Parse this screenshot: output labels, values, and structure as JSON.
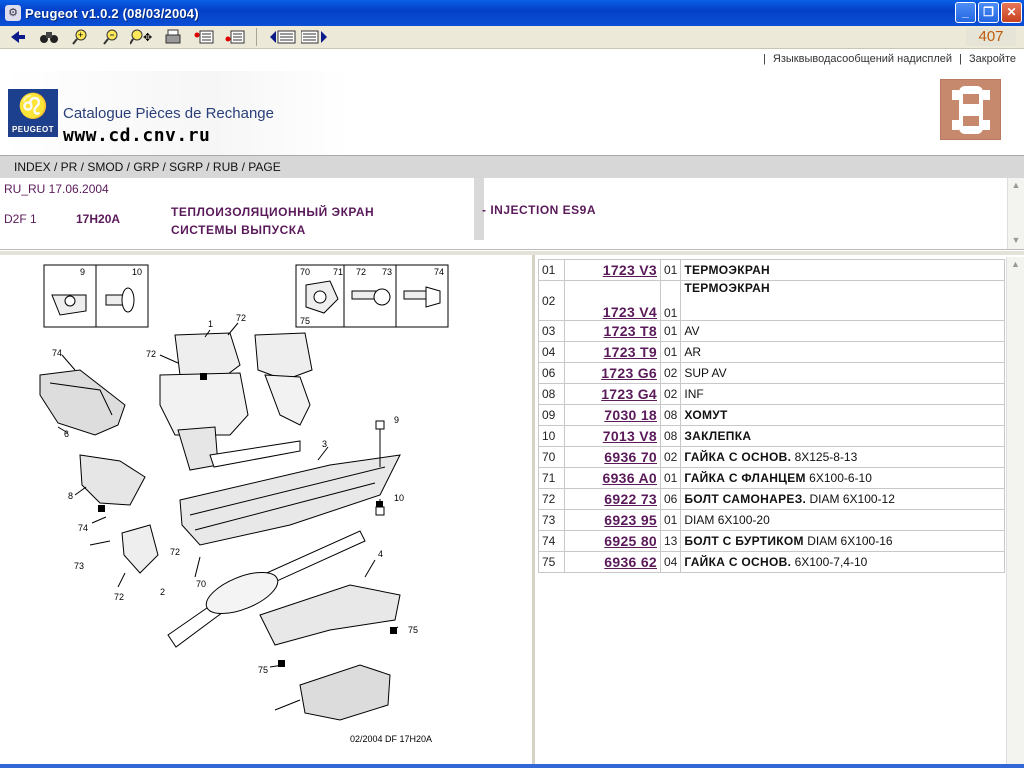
{
  "window": {
    "title": "Peugeot v1.0.2 (08/03/2004)",
    "page_number": "407"
  },
  "toolbar": {
    "icons": [
      "back-arrow-icon",
      "binoculars-icon",
      "zoom-in-icon",
      "zoom-out-icon",
      "zoom-move-icon",
      "print-icon",
      "list-red-icon",
      "list-red-alt-icon",
      "prev-page-icon",
      "next-page-icon"
    ]
  },
  "header": {
    "link_messages": "Языквыводасообщений надисплей",
    "link_close": "Закройте",
    "sep": "|",
    "catalogue_label": "Catalogue Pièces de Rechange",
    "site": "www.cd.cnv.ru",
    "brand": "PEUGEOT"
  },
  "breadcrumb": "INDEX / PR / SMOD / GRP / SGRP / RUB / PAGE",
  "info": {
    "date": "RU_RU 17.06.2004",
    "model": "D2F 1",
    "code": "17H20A",
    "desc_line1": "ТЕПЛОИЗОЛЯЦИОННЫЙ ЭКРАН",
    "desc_line2": "СИСТЕМЫ ВЫПУСКА",
    "engine": "- INJECTION ES9A"
  },
  "diagram": {
    "callouts": [
      "9",
      "10",
      "70",
      "71",
      "72",
      "73",
      "74",
      "75",
      "1",
      "72",
      "74",
      "6",
      "8",
      "74",
      "73",
      "72",
      "2",
      "3",
      "70",
      "10",
      "9",
      "4",
      "75",
      "75",
      "72"
    ],
    "caption": "02/2004  DF 17H20A"
  },
  "parts": [
    {
      "ref": "01",
      "part": "1723 V3",
      "qty": "01",
      "name": "ТЕРМОЭКРАН",
      "extra": ""
    },
    {
      "ref": "02",
      "part": "1723 V4",
      "qty": "01",
      "name": "ТЕРМОЭКРАН",
      "extra": ""
    },
    {
      "ref": "03",
      "part": "1723 T8",
      "qty": "01",
      "name": "",
      "extra": "AV"
    },
    {
      "ref": "04",
      "part": "1723 T9",
      "qty": "01",
      "name": "",
      "extra": "AR"
    },
    {
      "ref": "06",
      "part": "1723 G6",
      "qty": "02",
      "name": "",
      "extra": "SUP AV"
    },
    {
      "ref": "08",
      "part": "1723 G4",
      "qty": "02",
      "name": "",
      "extra": "INF"
    },
    {
      "ref": "09",
      "part": "7030 18",
      "qty": "08",
      "name": "ХОМУТ",
      "extra": ""
    },
    {
      "ref": "10",
      "part": "7013 V8",
      "qty": "08",
      "name": "ЗАКЛЕПКА",
      "extra": ""
    },
    {
      "ref": "70",
      "part": "6936 70",
      "qty": "02",
      "name": "ГАЙКА С ОСНОВ.",
      "extra": "8X125-8-13"
    },
    {
      "ref": "71",
      "part": "6936 A0",
      "qty": "01",
      "name": "ГАЙКА С ФЛАНЦЕМ",
      "extra": "6X100-6-10"
    },
    {
      "ref": "72",
      "part": "6922 73",
      "qty": "06",
      "name": "БОЛТ САМОНАРЕЗ.",
      "extra": "DIAM 6X100-12"
    },
    {
      "ref": "73",
      "part": "6923 95",
      "qty": "01",
      "name": "",
      "extra": "DIAM 6X100-20"
    },
    {
      "ref": "74",
      "part": "6925 80",
      "qty": "13",
      "name": "БОЛТ С БУРТИКОМ",
      "extra": "DIAM 6X100-16"
    },
    {
      "ref": "75",
      "part": "6936 62",
      "qty": "04",
      "name": "ГАЙКА С ОСНОВ.",
      "extra": "6X100-7,4-10"
    }
  ]
}
